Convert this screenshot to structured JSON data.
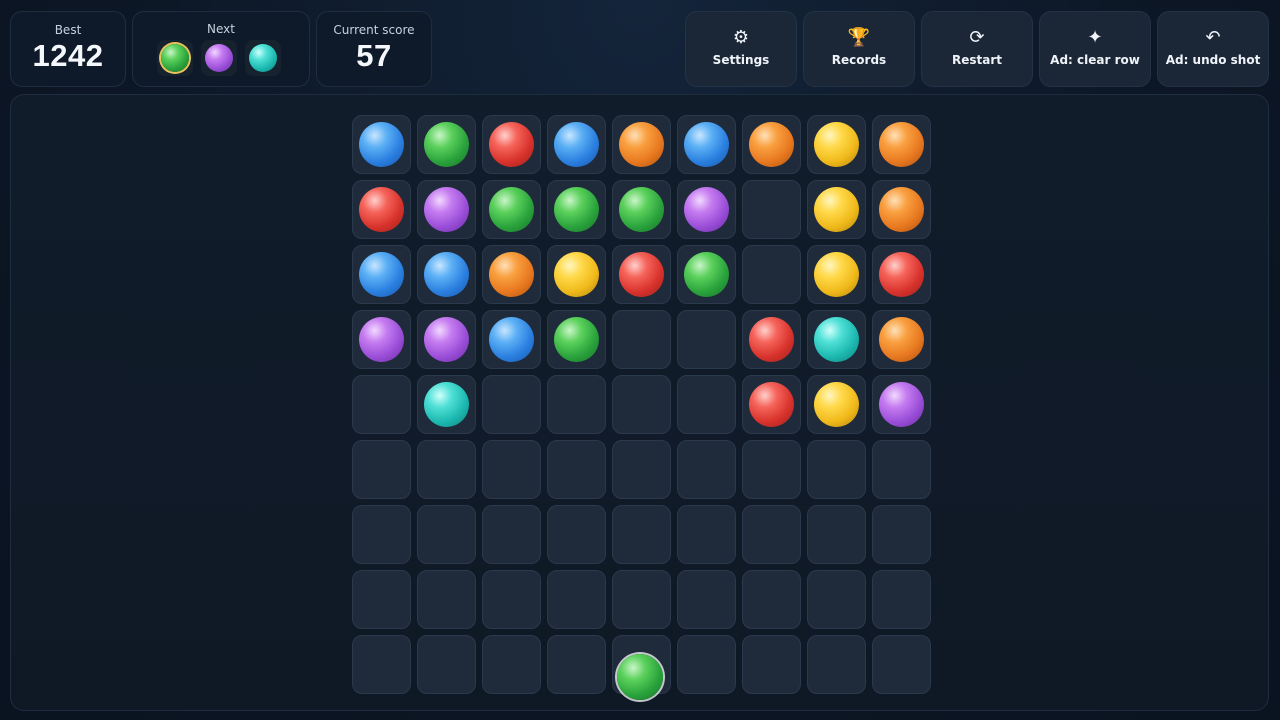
{
  "stats": {
    "best_label": "Best",
    "best_value": "1242",
    "next_label": "Next",
    "next_balls": [
      "green",
      "purple",
      "cyan"
    ],
    "score_label": "Current score",
    "score_value": "57"
  },
  "toolbar": [
    {
      "id": "settings",
      "icon": "gear-icon",
      "glyph": "⚙",
      "label": "Settings"
    },
    {
      "id": "records",
      "icon": "trophy-icon",
      "glyph": "🏆",
      "label": "Records"
    },
    {
      "id": "restart",
      "icon": "restart-icon",
      "glyph": "⟳",
      "label": "Restart"
    },
    {
      "id": "clear",
      "icon": "sparkle-icon",
      "glyph": "✦",
      "label": "Ad: clear row"
    },
    {
      "id": "undo",
      "icon": "undo-icon",
      "glyph": "↶",
      "label": "Ad: undo shot"
    }
  ],
  "board": {
    "columns": 9,
    "rows": [
      [
        "blue",
        "green",
        "red",
        "blue",
        "orange",
        "blue",
        "orange",
        "yellow",
        "orange"
      ],
      [
        "red",
        "purple",
        "green",
        "green",
        "green",
        "purple",
        null,
        "yellow",
        "orange"
      ],
      [
        "blue",
        "blue",
        "orange",
        "yellow",
        "red",
        "green",
        null,
        "yellow",
        "red"
      ],
      [
        "purple",
        "purple",
        "blue",
        "green",
        null,
        null,
        "red",
        "cyan",
        "orange"
      ],
      [
        null,
        "cyan",
        null,
        null,
        null,
        null,
        "red",
        "yellow",
        "purple"
      ],
      [
        null,
        null,
        null,
        null,
        null,
        null,
        null,
        null,
        null
      ],
      [
        null,
        null,
        null,
        null,
        null,
        null,
        null,
        null,
        null
      ],
      [
        null,
        null,
        null,
        null,
        null,
        null,
        null,
        null,
        null
      ],
      [
        null,
        null,
        null,
        null,
        null,
        null,
        null,
        null,
        null
      ]
    ]
  },
  "shooter": {
    "color": "green"
  },
  "colors": {
    "blue": "#2a7fe0",
    "green": "#2aa33c",
    "red": "#d8322c",
    "orange": "#e87820",
    "yellow": "#f0b91a",
    "purple": "#9a4ed8",
    "cyan": "#1cb8b0",
    "accent_ring": "#e8c35a"
  }
}
